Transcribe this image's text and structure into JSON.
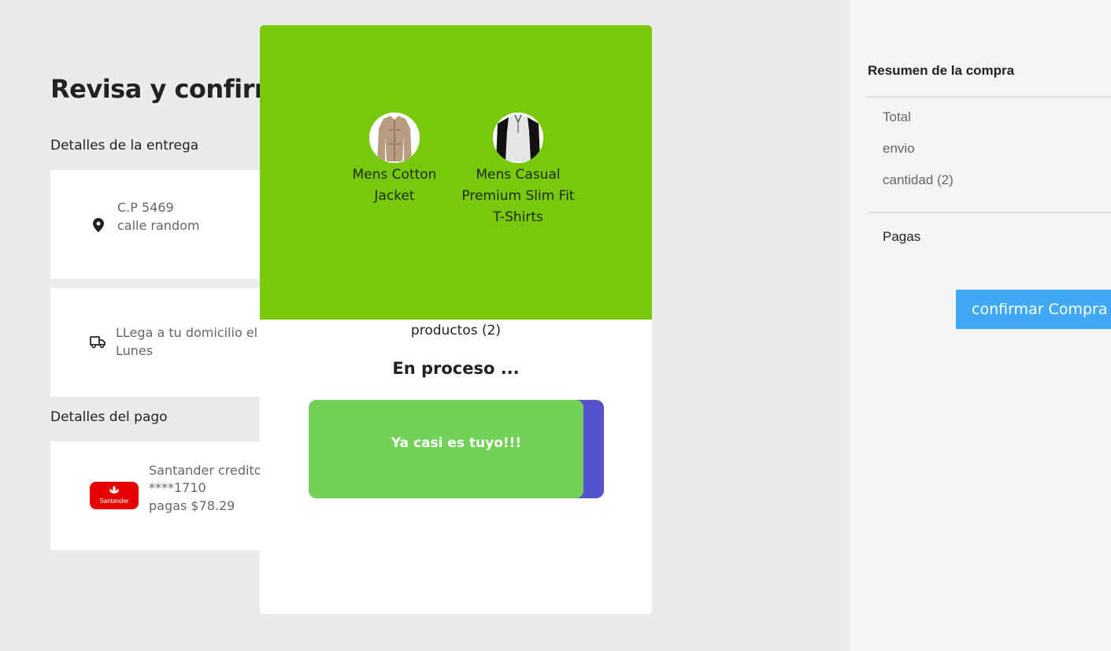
{
  "main": {
    "title": "Revisa y confirma",
    "delivery_label": "Detalles de la entrega",
    "address": {
      "postal_code": "C.P 5469",
      "street": "calle random"
    },
    "shipping": {
      "line1": "LLega a tu domicilio el",
      "line2": "Lunes"
    },
    "payment_label": "Detalles del pago",
    "payment": {
      "bank": "Santander credito",
      "card": "****1710",
      "amount": "pagas $78.29",
      "logo_text": "Santander"
    }
  },
  "summary": {
    "title": "Resumen de la compra",
    "rows": [
      "Total",
      "envio",
      "cantidad (2)"
    ],
    "pay_label": "Pagas",
    "confirm_label": "confirmar Compra"
  },
  "modal": {
    "products": [
      {
        "name_lines": [
          "Mens Cotton",
          "Jacket"
        ]
      },
      {
        "name_lines": [
          "Mens Casual",
          "Premium Slim Fit",
          "T-Shirts"
        ]
      }
    ],
    "products_count": "productos (2)",
    "status": "En proceso ...",
    "progress_text": "Ya casi es tuyo!!!",
    "progress": 0.93
  },
  "colors": {
    "modal_header": "#78c90e",
    "progress_fill": "#72d158",
    "progress_track": "#5552cc",
    "confirm_button": "#3fa9f5"
  },
  "icons": [
    "location-pin-icon",
    "truck-icon",
    "santander-logo"
  ]
}
